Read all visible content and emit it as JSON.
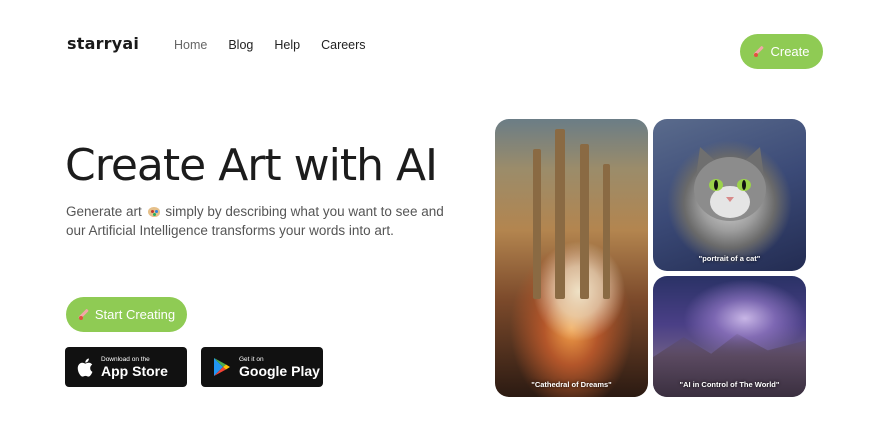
{
  "header": {
    "logo": "starryai",
    "nav": [
      "Home",
      "Blog",
      "Help",
      "Careers"
    ],
    "create_label": "Create"
  },
  "hero": {
    "title": "Create Art with AI",
    "subtitle_part1": "Generate art",
    "subtitle_part2": "simply by describing what you want to see and our Artificial Intelligence transforms your words into art.",
    "start_label": "Start Creating"
  },
  "stores": {
    "apple_small": "Download on the",
    "apple_big": "App Store",
    "google_small": "Get it on",
    "google_big": "Google Play"
  },
  "gallery": {
    "cathedral_caption": "\"Cathedral of Dreams\"",
    "cat_caption": "\"portrait of a cat\"",
    "galaxy_caption": "\"AI in Control of The World\""
  },
  "colors": {
    "accent": "#8fcb54",
    "text_dark": "#1c1c1c",
    "store_bg": "#111111"
  },
  "icons": [
    "paintbrush-icon",
    "palette-icon",
    "apple-icon",
    "google-play-icon"
  ]
}
